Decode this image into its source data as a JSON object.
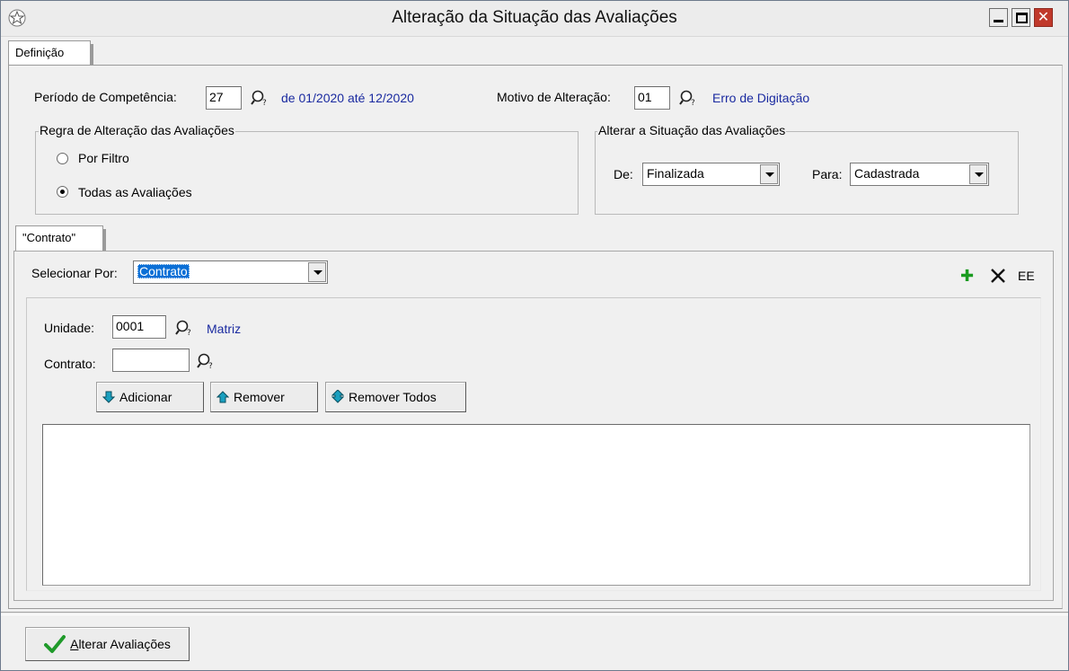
{
  "window": {
    "title": "Alteração da Situação das Avaliações",
    "min_label": "_",
    "max_label": "□",
    "close_label": "✕"
  },
  "tabs": {
    "outer": "Definição",
    "inner": "\"Contrato\""
  },
  "periodo": {
    "label": "Período de Competência:",
    "value": "27",
    "description": "de 01/2020 até 12/2020"
  },
  "motivo": {
    "label": "Motivo de Alteração:",
    "value": "01",
    "description": "Erro de Digitação"
  },
  "regra": {
    "title": "Regra de Alteração das Avaliações",
    "options": [
      {
        "label": "Por Filtro",
        "checked": false
      },
      {
        "label": "Todas as Avaliações",
        "checked": true
      }
    ]
  },
  "alterar_situacao": {
    "title": "Alterar a Situação das Avaliações",
    "de_label": "De:",
    "de_value": "Finalizada",
    "para_label": "Para:",
    "para_value": "Cadastrada"
  },
  "selecionar": {
    "label": "Selecionar Por:",
    "value": "Contrato"
  },
  "toolbar": {
    "add_icon": "plus-icon",
    "remove_icon": "x-icon",
    "ee_label": "EE"
  },
  "unidade": {
    "label": "Unidade:",
    "value": "0001",
    "description": "Matriz"
  },
  "contrato": {
    "label": "Contrato:",
    "value": ""
  },
  "buttons": {
    "adicionar": "Adicionar",
    "remover": "Remover",
    "remover_todos": "Remover Todos"
  },
  "footer": {
    "alterar_prefix": "A",
    "alterar_rest": "lterar Avaliações"
  },
  "colors": {
    "link": "#1a2aa0",
    "selection": "#0b6fd6",
    "close": "#c0392b",
    "ok_check": "#1f9a2a",
    "arrow_icon": "#1aa0c0"
  }
}
